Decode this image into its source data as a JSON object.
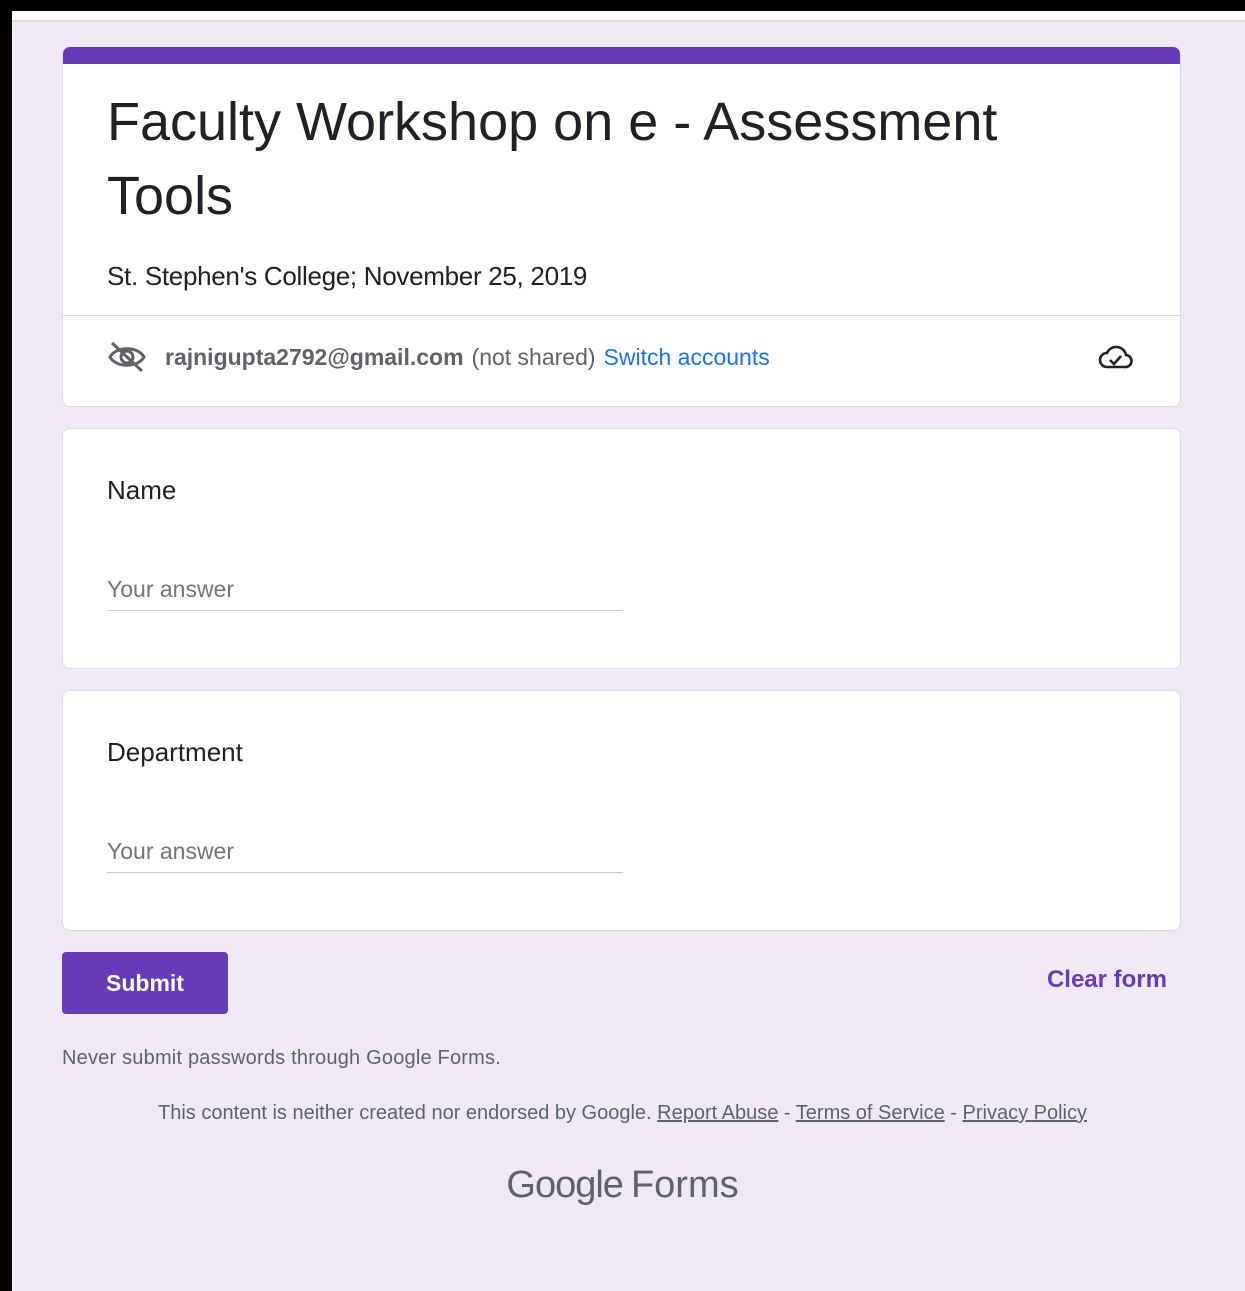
{
  "form": {
    "title": "Faculty Workshop on e - Assessment Tools",
    "description": "St. Stephen's College; November 25, 2019",
    "account": {
      "email": "rajnigupta2792@gmail.com",
      "shared_status": "(not shared)",
      "switch_label": "Switch accounts"
    },
    "accent_color": "#673ab7",
    "background_color": "#efe9f6"
  },
  "questions": [
    {
      "title": "Name",
      "placeholder": "Your answer",
      "value": ""
    },
    {
      "title": "Department",
      "placeholder": "Your answer",
      "value": ""
    }
  ],
  "actions": {
    "submit_label": "Submit",
    "clear_label": "Clear form"
  },
  "footer": {
    "warning": "Never submit passwords through Google Forms.",
    "disclaimer": "This content is neither created nor endorsed by Google.",
    "report_abuse": "Report Abuse",
    "separator": " - ",
    "terms": "Terms of Service",
    "privacy": "Privacy Policy",
    "brand_google": "Google",
    "brand_forms": "Forms"
  },
  "icons": {
    "visibility": "visibility-off-icon",
    "cloud": "cloud-done-icon"
  }
}
